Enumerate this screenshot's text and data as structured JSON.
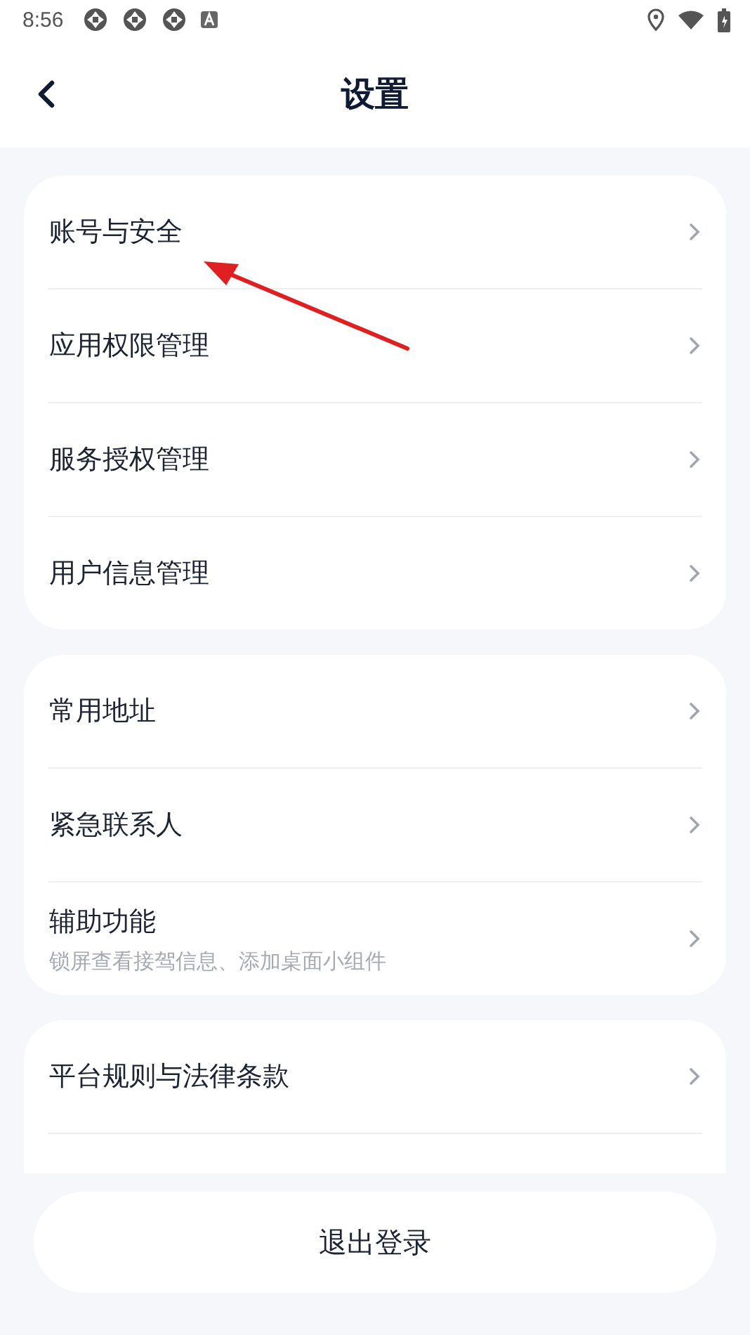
{
  "status_bar": {
    "time": "8:56"
  },
  "header": {
    "title": "设置"
  },
  "groups": [
    {
      "items": [
        {
          "label": "账号与安全"
        },
        {
          "label": "应用权限管理"
        },
        {
          "label": "服务授权管理"
        },
        {
          "label": "用户信息管理"
        }
      ]
    },
    {
      "items": [
        {
          "label": "常用地址"
        },
        {
          "label": "紧急联系人"
        },
        {
          "label": "辅助功能",
          "subtitle": "锁屏查看接驾信息、添加桌面小组件"
        }
      ]
    },
    {
      "items": [
        {
          "label": "平台规则与法律条款"
        }
      ]
    }
  ],
  "logout_button": "退出登录"
}
